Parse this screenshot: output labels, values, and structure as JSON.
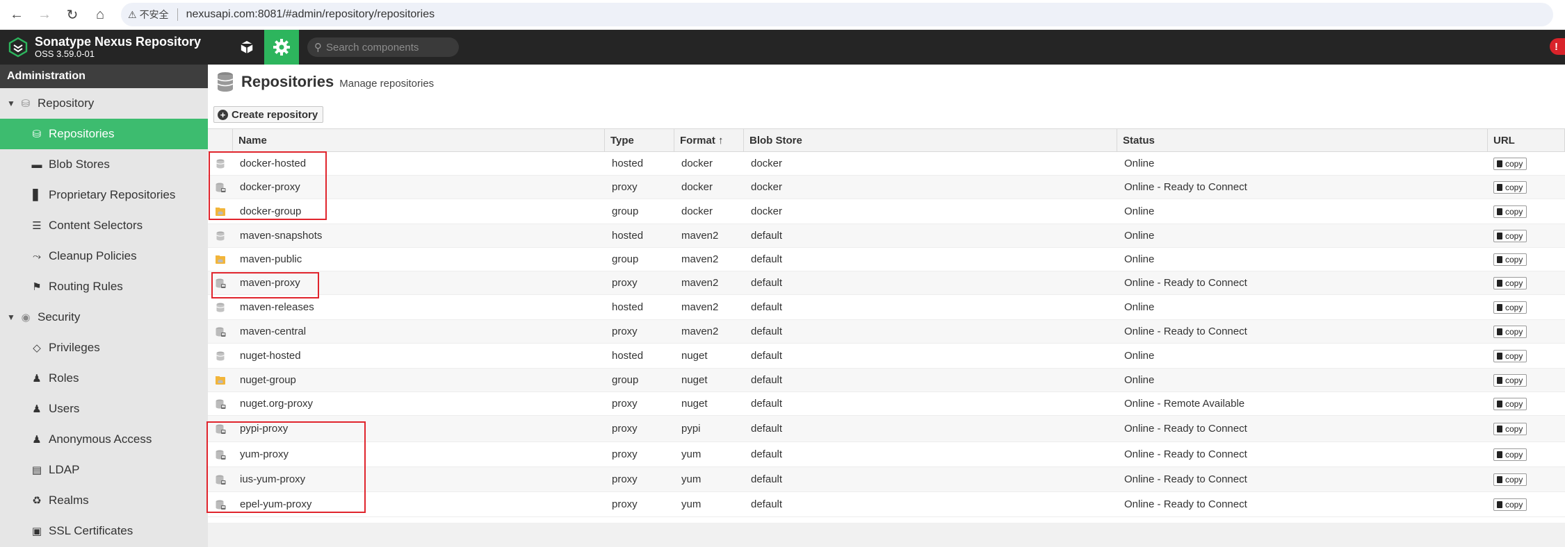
{
  "browser": {
    "insecure_label": "不安全",
    "url": "nexusapi.com:8081/#admin/repository/repositories"
  },
  "header": {
    "app_name": "Sonatype Nexus Repository",
    "version": "OSS 3.59.0-01",
    "search_placeholder": "Search components",
    "alert": "!"
  },
  "sidebar": {
    "title": "Administration",
    "items": [
      {
        "label": "Repository",
        "type": "group",
        "icon": "database-icon"
      },
      {
        "label": "Repositories",
        "type": "child",
        "icon": "database-icon",
        "active": true
      },
      {
        "label": "Blob Stores",
        "type": "child",
        "icon": "hdd-icon"
      },
      {
        "label": "Proprietary Repositories",
        "type": "child",
        "icon": "door-icon"
      },
      {
        "label": "Content Selectors",
        "type": "child",
        "icon": "layers-icon"
      },
      {
        "label": "Cleanup Policies",
        "type": "child",
        "icon": "broom-icon"
      },
      {
        "label": "Routing Rules",
        "type": "child",
        "icon": "signpost-icon"
      },
      {
        "label": "Security",
        "type": "group",
        "icon": "eye-icon"
      },
      {
        "label": "Privileges",
        "type": "child",
        "icon": "badge-icon"
      },
      {
        "label": "Roles",
        "type": "child",
        "icon": "user-gear-icon"
      },
      {
        "label": "Users",
        "type": "child",
        "icon": "users-icon"
      },
      {
        "label": "Anonymous Access",
        "type": "child",
        "icon": "user-icon"
      },
      {
        "label": "LDAP",
        "type": "child",
        "icon": "book-icon"
      },
      {
        "label": "Realms",
        "type": "child",
        "icon": "realm-icon"
      },
      {
        "label": "SSL Certificates",
        "type": "child",
        "icon": "certificate-icon"
      }
    ]
  },
  "page": {
    "title": "Repositories",
    "subtitle": "Manage repositories",
    "create_label": "Create repository"
  },
  "table": {
    "columns": [
      "Name",
      "Type",
      "Format ↑",
      "Blob Store",
      "Status",
      "URL"
    ],
    "copy_label": "copy",
    "rows": [
      {
        "name": "docker-hosted",
        "type": "hosted",
        "format": "docker",
        "blob": "docker",
        "status": "Online"
      },
      {
        "name": "docker-proxy",
        "type": "proxy",
        "format": "docker",
        "blob": "docker",
        "status": "Online - Ready to Connect"
      },
      {
        "name": "docker-group",
        "type": "group",
        "format": "docker",
        "blob": "docker",
        "status": "Online"
      },
      {
        "name": "maven-snapshots",
        "type": "hosted",
        "format": "maven2",
        "blob": "default",
        "status": "Online"
      },
      {
        "name": "maven-public",
        "type": "group",
        "format": "maven2",
        "blob": "default",
        "status": "Online"
      },
      {
        "name": "maven-proxy",
        "type": "proxy",
        "format": "maven2",
        "blob": "default",
        "status": "Online - Ready to Connect"
      },
      {
        "name": "maven-releases",
        "type": "hosted",
        "format": "maven2",
        "blob": "default",
        "status": "Online"
      },
      {
        "name": "maven-central",
        "type": "proxy",
        "format": "maven2",
        "blob": "default",
        "status": "Online - Ready to Connect"
      },
      {
        "name": "nuget-hosted",
        "type": "hosted",
        "format": "nuget",
        "blob": "default",
        "status": "Online"
      },
      {
        "name": "nuget-group",
        "type": "group",
        "format": "nuget",
        "blob": "default",
        "status": "Online"
      },
      {
        "name": "nuget.org-proxy",
        "type": "proxy",
        "format": "nuget",
        "blob": "default",
        "status": "Online - Remote Available"
      },
      {
        "name": "pypi-proxy",
        "type": "proxy",
        "format": "pypi",
        "blob": "default",
        "status": "Online - Ready to Connect"
      },
      {
        "name": "yum-proxy",
        "type": "proxy",
        "format": "yum",
        "blob": "default",
        "status": "Online - Ready to Connect"
      },
      {
        "name": "ius-yum-proxy",
        "type": "proxy",
        "format": "yum",
        "blob": "default",
        "status": "Online - Ready to Connect"
      },
      {
        "name": "epel-yum-proxy",
        "type": "proxy",
        "format": "yum",
        "blob": "default",
        "status": "Online - Ready to Connect"
      }
    ]
  },
  "colors": {
    "accent_green": "#2db55d",
    "header_dark": "#252525",
    "highlight_red": "#e0242c"
  }
}
